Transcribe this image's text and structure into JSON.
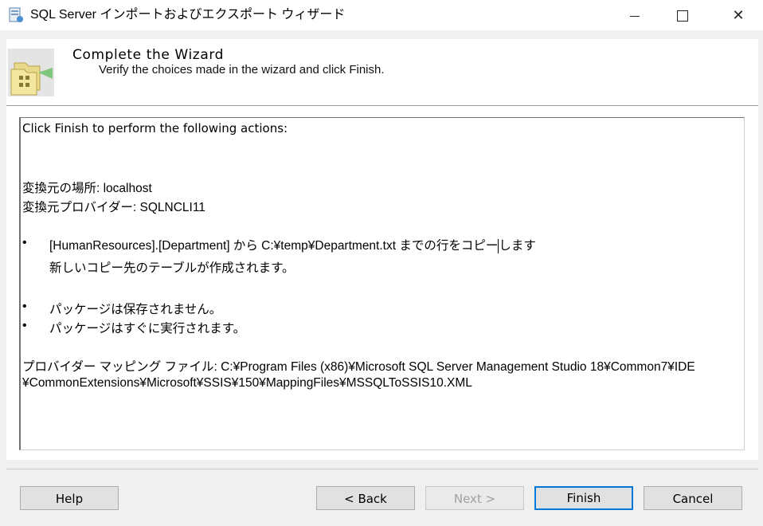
{
  "window": {
    "title": "SQL Server インポートおよびエクスポート ウィザード",
    "close_glyph": "✕"
  },
  "header": {
    "title": "Complete the Wizard",
    "subtitle": "Verify the choices made in the wizard and click Finish."
  },
  "content": {
    "heading": "Click Finish to perform the following actions:",
    "source_location": "変換元の場所: localhost",
    "source_provider": "変換元プロバイダー: SQLNCLI11",
    "actions": [
      {
        "bullet": "•",
        "line1_pre": "[HumanResources].[Department] から C:¥temp¥Department.txt までの行をコピー",
        "line1_post": "します",
        "line2": "新しいコピー先のテーブルが作成されます。"
      },
      {
        "bullet": "•",
        "line1": "パッケージは保存されません。"
      },
      {
        "bullet": "•",
        "line1": "パッケージはすぐに実行されます。"
      }
    ],
    "mapping_line1": "プロバイダー マッピング ファイル: C:¥Program Files (x86)¥Microsoft SQL Server Management Studio 18¥Common7¥IDE",
    "mapping_line2": "¥CommonExtensions¥Microsoft¥SSIS¥150¥MappingFiles¥MSSQLToSSIS10.XML"
  },
  "buttons": {
    "help": "Help",
    "back": "< Back",
    "next": "Next >",
    "finish": "Finish",
    "cancel": "Cancel"
  },
  "colors": {
    "accent_focus": "#0078d7",
    "disabled_text": "#a0a0a0"
  }
}
